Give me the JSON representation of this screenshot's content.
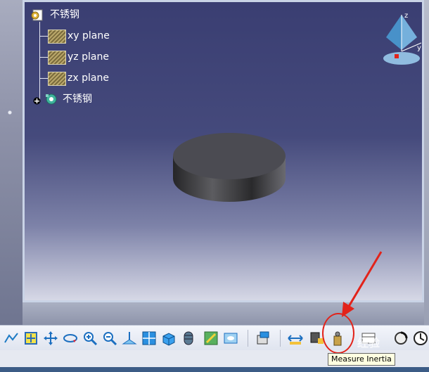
{
  "tree": {
    "root_label": "不锈钢",
    "planes": [
      "xy plane",
      "yz plane",
      "zx plane"
    ],
    "part_label": "不锈钢"
  },
  "compass": {
    "axes": [
      "z",
      "y"
    ]
  },
  "toolbar": {
    "tooltip": "Measure Inertia",
    "icons": [
      "fit-all-icon",
      "center-graph-icon",
      "pan-icon",
      "rotate-icon",
      "zoom-in-icon",
      "zoom-out-icon",
      "normal-view-icon",
      "multi-view-icon",
      "iso-view-icon",
      "hide-show-icon",
      "swap-space-icon",
      "shading-icon",
      "apply-material-icon",
      "measure-between-icon",
      "measure-item-icon",
      "measure-inertia-icon",
      "catalog-icon",
      "repeat-icon",
      "catalog-browser-icon"
    ]
  },
  "watermark": "经验"
}
